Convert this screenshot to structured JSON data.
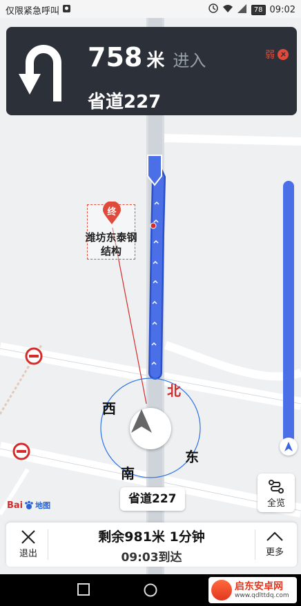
{
  "status_bar": {
    "carrier_text": "仅限紧急呼叫",
    "battery": "78",
    "time": "09:02"
  },
  "guidance": {
    "distance": "758",
    "unit": "米",
    "action": "进入",
    "road": "省道227",
    "signal": "弱"
  },
  "map": {
    "destination_marker": "终",
    "destination_name_line1": "潍坊东泰钢",
    "destination_name_line2": "结构",
    "compass_north": "北",
    "compass_south": "南",
    "compass_east": "东",
    "compass_west": "西",
    "current_road_label": "省道227",
    "logo_bai": "Bai",
    "logo_du": "du",
    "logo_map": "地图"
  },
  "overview": {
    "label": "全览"
  },
  "bottom_panel": {
    "exit_label": "退出",
    "remaining": "剩余981米 1分钟",
    "arrival": "09:03到达",
    "more_label": "更多"
  },
  "watermark": {
    "name": "启东安卓网",
    "url": "www.qdlttdq.com"
  },
  "colors": {
    "route_blue": "#4a6fe6",
    "banner_bg": "#2c3139",
    "accent_red": "#d52b2b"
  }
}
